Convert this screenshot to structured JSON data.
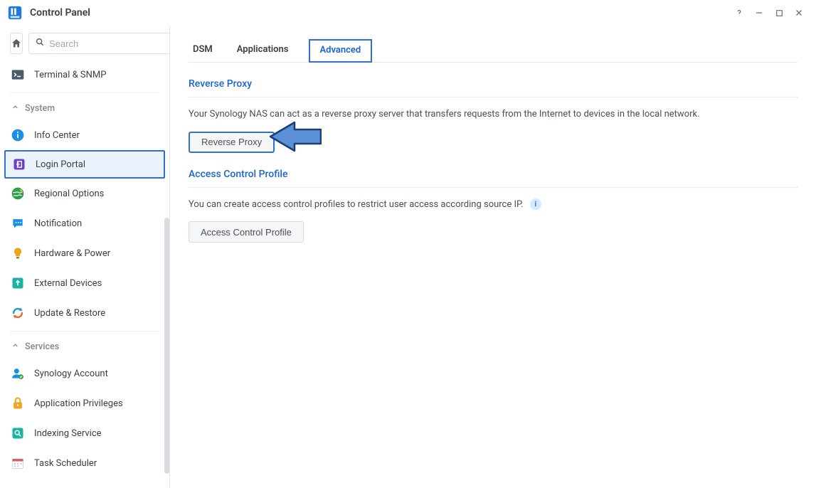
{
  "window": {
    "title": "Control Panel"
  },
  "search": {
    "placeholder": "Search"
  },
  "sidebar": {
    "top_item": {
      "label": "Terminal & SNMP",
      "icon": "terminal-icon",
      "color": "#4a5a6a"
    },
    "groups": [
      {
        "name": "System",
        "items": [
          {
            "label": "Info Center",
            "icon": "info-icon",
            "color": "#1a8fe3"
          },
          {
            "label": "Login Portal",
            "icon": "portal-icon",
            "color": "#6b3fc9",
            "active": true
          },
          {
            "label": "Regional Options",
            "icon": "globe-icon",
            "color": "#2aa04a"
          },
          {
            "label": "Notification",
            "icon": "chat-icon",
            "color": "#1a8fe3"
          },
          {
            "label": "Hardware & Power",
            "icon": "bulb-icon",
            "color": "#f2a418"
          },
          {
            "label": "External Devices",
            "icon": "upload-icon",
            "color": "#17b3a3"
          },
          {
            "label": "Update & Restore",
            "icon": "refresh-icon",
            "color": "#f26a1b"
          }
        ]
      },
      {
        "name": "Services",
        "items": [
          {
            "label": "Synology Account",
            "icon": "account-icon",
            "color": "#1a8fe3"
          },
          {
            "label": "Application Privileges",
            "icon": "lock-icon",
            "color": "#f2a418"
          },
          {
            "label": "Indexing Service",
            "icon": "search-svc-icon",
            "color": "#17b3a3"
          },
          {
            "label": "Task Scheduler",
            "icon": "calendar-icon",
            "color": "#e05a5a"
          }
        ]
      }
    ]
  },
  "tabs": [
    {
      "label": "DSM",
      "active": false
    },
    {
      "label": "Applications",
      "active": false
    },
    {
      "label": "Advanced",
      "active": true
    }
  ],
  "sections": {
    "reverse_proxy": {
      "title": "Reverse Proxy",
      "desc": "Your Synology NAS can act as a reverse proxy server that transfers requests from the Internet to devices in the local network.",
      "button": "Reverse Proxy"
    },
    "access_control": {
      "title": "Access Control Profile",
      "desc": "You can create access control profiles to restrict user access according source IP.",
      "button": "Access Control Profile"
    }
  }
}
